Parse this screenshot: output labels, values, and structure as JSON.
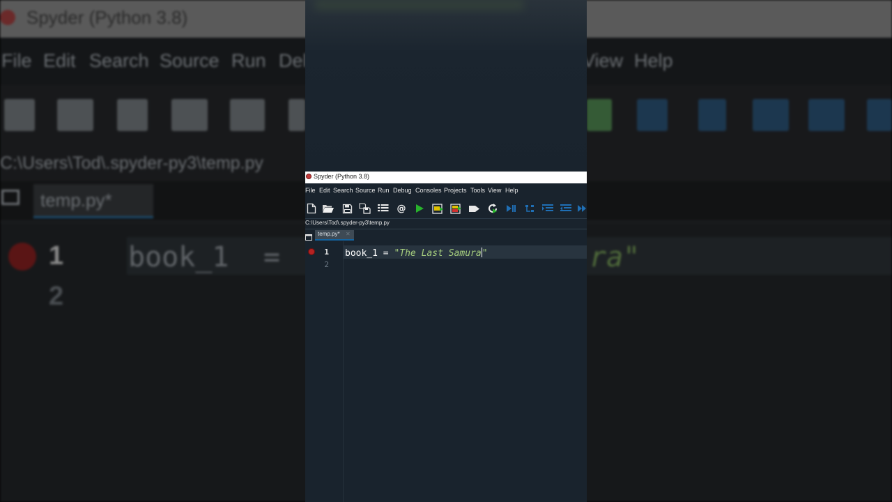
{
  "window": {
    "title": "Spyder (Python 3.8)"
  },
  "menu": [
    "File",
    "Edit",
    "Search",
    "Source",
    "Run",
    "Debug",
    "Consoles",
    "Projects",
    "Tools",
    "View",
    "Help"
  ],
  "background": {
    "menu_left": [
      "File",
      "Edit",
      "Search",
      "Source",
      "Run",
      "Del"
    ],
    "menu_right": [
      "View",
      "Help"
    ],
    "path": "C:\\Users\\Tod\\.spyder-py3\\temp.py",
    "tab": "temp.py*",
    "line1": "1",
    "line2": "2",
    "code_ident": "book_1",
    "code_op": "=",
    "code_tail": "ra\""
  },
  "toolbar": {
    "icons": [
      "new-file-icon",
      "open-folder-icon",
      "save-icon",
      "save-all-icon",
      "outline-list-icon",
      "at-icon",
      "run-icon",
      "run-cell-icon",
      "run-cell-advance-icon",
      "run-selection-icon",
      "rerun-icon",
      "debug-step-icon",
      "debug-loop-icon",
      "indent-icon",
      "dedent-icon",
      "continue-icon"
    ]
  },
  "path": "C:\\Users\\Tod\\.spyder-py3\\temp.py",
  "editor": {
    "tab_label": "temp.py*",
    "line_numbers": [
      "1",
      "2"
    ],
    "code": {
      "identifier": "book_1",
      "operator": "=",
      "string_open": "\"The Last Samura",
      "string_close": "\""
    }
  },
  "colors": {
    "background": "#19232d",
    "string": "#a6ce7e",
    "run_green": "#28b22c",
    "breakpoint": "#b52222",
    "tab_accent": "#1464a0"
  }
}
